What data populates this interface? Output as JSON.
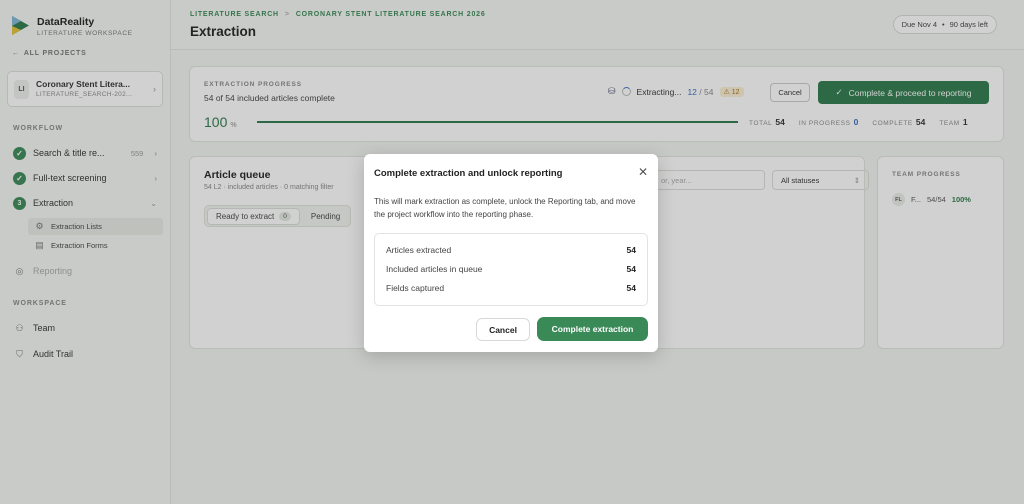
{
  "brand": {
    "name": "DataReality",
    "subtitle": "LITERATURE WORKSPACE"
  },
  "sidebar": {
    "all_projects": "ALL PROJECTS",
    "project": {
      "badge": "LI",
      "title": "Coronary Stent Litera...",
      "subtitle": "LITERATURE_SEARCH-202..."
    },
    "workflow_label": "WORKFLOW",
    "workflow": [
      {
        "label": "Search & title re...",
        "count": "559",
        "state": "done"
      },
      {
        "label": "Full-text screening",
        "count": "",
        "state": "done"
      },
      {
        "label": "Extraction",
        "step": "3",
        "state": "active"
      }
    ],
    "extraction_sub": [
      {
        "label": "Extraction Lists",
        "active": true
      },
      {
        "label": "Extraction Forms",
        "active": false
      }
    ],
    "reporting": "Reporting",
    "workspace_label": "WORKSPACE",
    "workspace": [
      {
        "label": "Team",
        "icon": "team-icon"
      },
      {
        "label": "Audit Trail",
        "icon": "shield-icon"
      }
    ]
  },
  "header": {
    "breadcrumb": [
      "LITERATURE SEARCH",
      "CORONARY STENT LITERATURE SEARCH 2026"
    ],
    "separator": ">",
    "title": "Extraction",
    "due": "Due Nov 4",
    "days_left": "90 days left",
    "dot": "•"
  },
  "progress": {
    "label": "EXTRACTION PROGRESS",
    "summary": "54 of 54 included articles complete",
    "percent_value": 100,
    "percent": "100",
    "percent_unit": "%",
    "extracting_label": "Extracting...",
    "extracting_done": "12",
    "extracting_sep": "/",
    "extracting_total": "54",
    "warning_count": "12",
    "cancel": "Cancel",
    "complete_button": "Complete & proceed to reporting",
    "stats": [
      {
        "label": "TOTAL",
        "value": "54"
      },
      {
        "label": "IN PROGRESS",
        "value": "0"
      },
      {
        "label": "COMPLETE",
        "value": "54"
      },
      {
        "label": "TEAM",
        "value": "1"
      }
    ]
  },
  "queue": {
    "title": "Article queue",
    "subtitle": "54 L2 · included articles · 0 matching filter",
    "tabs": [
      {
        "label": "Ready to extract",
        "count": "0"
      },
      {
        "label": "Pending",
        "count": ""
      }
    ],
    "search_placeholder": "or, year...",
    "status_filter": "All statuses"
  },
  "team": {
    "label": "TEAM PROGRESS",
    "member_initials": "FL",
    "member_name": "F...",
    "member_progress": "54/54",
    "member_pct": "100%"
  },
  "modal": {
    "title": "Complete extraction and unlock reporting",
    "body": "This will mark extraction as complete, unlock the Reporting tab, and move the project workflow into the reporting phase.",
    "rows": [
      {
        "label": "Articles extracted",
        "value": "54"
      },
      {
        "label": "Included articles in queue",
        "value": "54"
      },
      {
        "label": "Fields captured",
        "value": "54"
      }
    ],
    "cancel": "Cancel",
    "confirm": "Complete extraction"
  },
  "colors": {
    "accent": "#3a8a58",
    "link_blue": "#3a6fbf",
    "warning": "#a07010"
  }
}
